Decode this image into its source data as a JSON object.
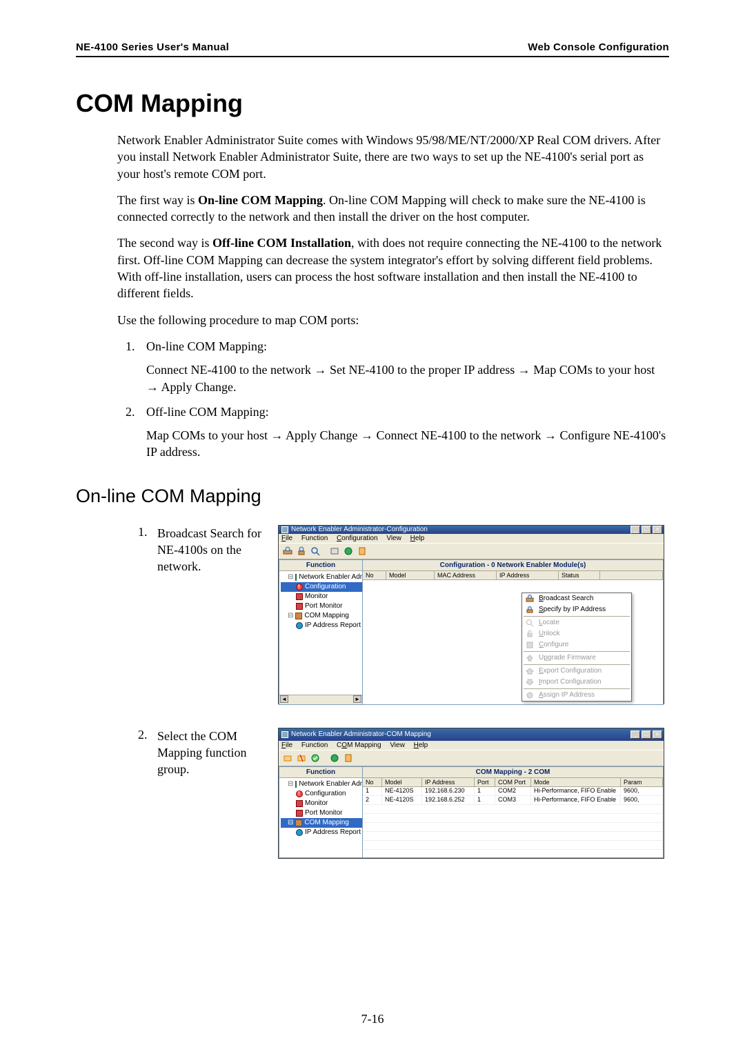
{
  "header": {
    "left": "NE-4100 Series User's Manual",
    "right": "Web Console Configuration"
  },
  "section_title": "COM Mapping",
  "intro": "Network Enabler Administrator Suite comes with Windows 95/98/ME/NT/2000/XP Real COM drivers. After you install Network Enabler Administrator Suite, there are two ways to set up the NE-4100's serial port as your host's remote COM port.",
  "para2_pre": "The first way is ",
  "para2_bold": "On-line COM Mapping",
  "para2_post": ". On-line COM Mapping will check to make sure the NE-4100 is connected correctly to the network and then install the driver on the host computer.",
  "para3_pre": "The second way is ",
  "para3_bold": "Off-line COM Installation",
  "para3_post": ", with does not require connecting the NE-4100 to the network first. Off-line COM Mapping can decrease the system integrator's effort by solving different field problems. With off-line installation, users can process the host software installation and then install the NE-4100 to different fields.",
  "para4": "Use the following procedure to map COM ports:",
  "proc": [
    {
      "title": "On-line COM Mapping:",
      "detail": "Connect NE-4100 to the network → Set NE-4100 to the proper IP address → Map COMs to your host → Apply Change."
    },
    {
      "title": "Off-line COM Mapping:",
      "detail": "Map COMs to your host → Apply Change → Connect NE-4100 to the network → Configure NE-4100's IP address."
    }
  ],
  "subsection_title": "On-line COM Mapping",
  "step1": {
    "num": "1.",
    "text": "Broadcast Search for NE-4100s on the network."
  },
  "step2": {
    "num": "2.",
    "text": "Select the COM Mapping function group."
  },
  "win1": {
    "title": "Network Enabler Administrator-Configuration",
    "menus": [
      "File",
      "Function",
      "Configuration",
      "View",
      "Help"
    ],
    "tree_head": "Function",
    "grid_title": "Configuration - 0 Network Enabler Module(s)",
    "tree_items": {
      "root": "Network Enabler Admi…",
      "configuration": "Configuration",
      "monitor": "Monitor",
      "port_monitor": "Port Monitor",
      "com_mapping": "COM Mapping",
      "ip_report": "IP Address Report"
    },
    "grid_headers": [
      "No",
      "Model",
      "MAC Address",
      "IP Address",
      "Status"
    ],
    "ctx": {
      "broadcast": "Broadcast Search",
      "specify": "Specify by IP Address",
      "locate": "Locate",
      "unlock": "Unlock",
      "configure": "Configure",
      "upgrade": "Upgrade Firmware",
      "export": "Export Configuration",
      "import": "Import Configuration",
      "assign": "Assign IP Address"
    }
  },
  "win2": {
    "title": "Network Enabler Administrator-COM Mapping",
    "menus": [
      "File",
      "Function",
      "COM Mapping",
      "View",
      "Help"
    ],
    "tree_head": "Function",
    "grid_title": "COM Mapping - 2 COM",
    "tree_items": {
      "root": "Network Enabler Admi…",
      "configuration": "Configuration",
      "monitor": "Monitor",
      "port_monitor": "Port Monitor",
      "com_mapping": "COM Mapping",
      "ip_report": "IP Address Report"
    },
    "grid_headers": [
      "No",
      "Model",
      "IP Address",
      "Port",
      "COM Port",
      "Mode",
      "Param"
    ],
    "rows": [
      {
        "no": "1",
        "model": "NE-4120S",
        "ip": "192.168.6.230",
        "port": "1",
        "com": "COM2",
        "mode": "Hi-Performance, FIFO Enable",
        "param": "9600, "
      },
      {
        "no": "2",
        "model": "NE-4120S",
        "ip": "192.168.6.252",
        "port": "1",
        "com": "COM3",
        "mode": "Hi-Performance, FIFO Enable",
        "param": "9600, "
      }
    ]
  },
  "page_number": "7-16"
}
